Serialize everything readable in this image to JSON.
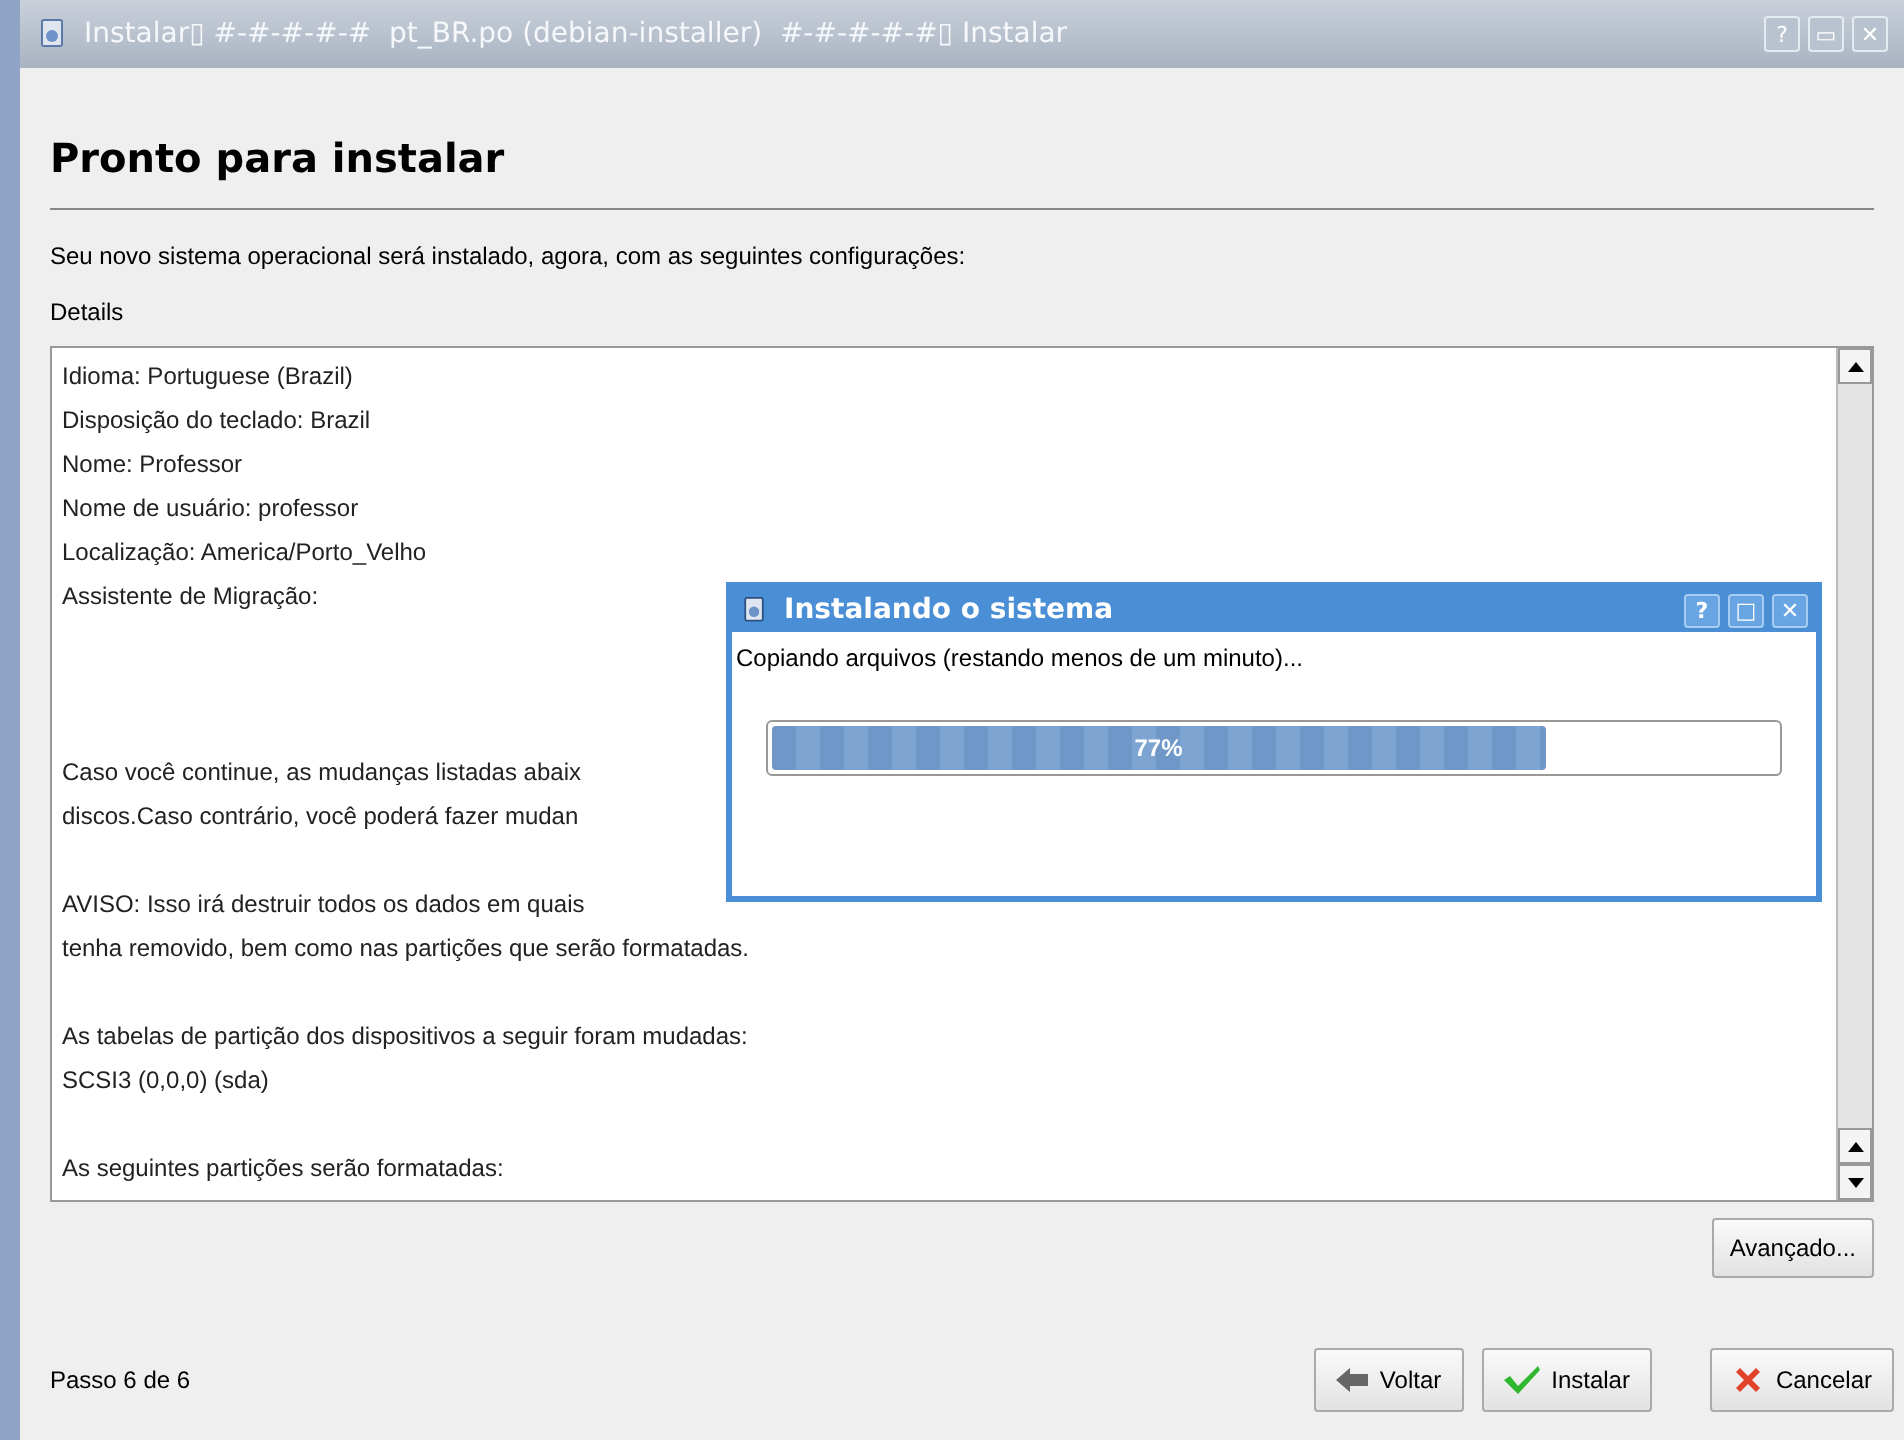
{
  "window": {
    "title": "Instalar▯ #-#-#-#-#  pt_BR.po (debian-installer)  #-#-#-#-#▯ Instalar",
    "controls": [
      "?",
      "▭",
      "✕"
    ]
  },
  "heading": "Pronto para instalar",
  "intro": "Seu novo sistema operacional será instalado, agora, com as seguintes configurações:",
  "details_label": "Details",
  "details_paragraphs": [
    [
      "Idioma: Portuguese (Brazil)",
      "Disposição do teclado: Brazil",
      "Nome: Professor",
      "Nome de usuário: professor",
      "Localização: America/Porto_Velho",
      "Assistente de Migração:"
    ],
    [
      "Caso você continue, as mudanças listadas abaix",
      "discos.Caso contrário, você poderá fazer mudan"
    ],
    [
      "AVISO: Isso irá destruir todos os dados em quais",
      "tenha removido, bem como nas partições que serão formatadas."
    ],
    [
      "As tabelas de partição dos dispositivos a seguir foram mudadas:",
      "SCSI3 (0,0,0) (sda)"
    ],
    [
      "As seguintes partições serão formatadas:"
    ]
  ],
  "advanced_button": "Avançado...",
  "step": "Passo 6 de 6",
  "buttons": [
    {
      "kind": "back",
      "label": "Voltar"
    },
    {
      "kind": "install",
      "label": "Instalar"
    },
    {
      "kind": "cancel",
      "label": "Cancelar"
    }
  ],
  "progress_dialog": {
    "title": "Instalando o sistema",
    "controls": [
      "?",
      "□",
      "✕"
    ],
    "message": "Copiando arquivos (restando menos de um minuto)...",
    "level": 0.77,
    "reading": "77%"
  }
}
